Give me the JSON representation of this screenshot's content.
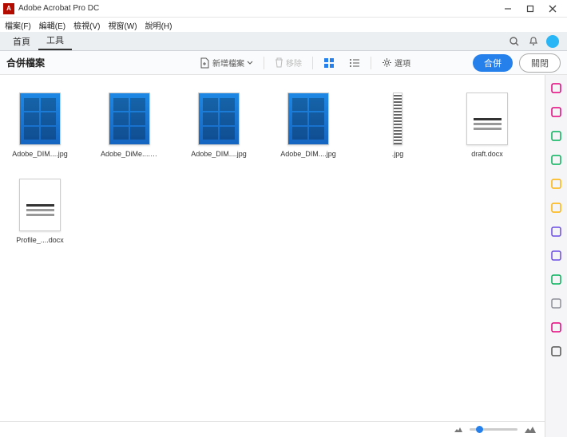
{
  "window": {
    "title": "Adobe Acrobat Pro DC"
  },
  "menu": {
    "file": "檔案(F)",
    "edit": "編輯(E)",
    "view": "檢視(V)",
    "window": "視窗(W)",
    "help": "說明(H)"
  },
  "tabs": {
    "home": "首頁",
    "tools": "工具"
  },
  "toolbar": {
    "title": "合併檔案",
    "add": "新增檔案",
    "delete": "移除",
    "options": "選項",
    "combine": "合併",
    "close": "關閉"
  },
  "files": [
    {
      "name": "Adobe_DIM....jpg",
      "kind": "blue"
    },
    {
      "name": "Adobe_DiMe....jpg",
      "kind": "blue"
    },
    {
      "name": "Adobe_DIM....jpg",
      "kind": "blue"
    },
    {
      "name": "Adobe_DIM....jpg",
      "kind": "blue"
    },
    {
      "name": ".jpg",
      "kind": "jpg-narrow"
    },
    {
      "name": "draft.docx",
      "kind": "docstack"
    },
    {
      "name": "Profile_....docx",
      "kind": "doc"
    }
  ],
  "side_icons": [
    {
      "name": "create-pdf-icon",
      "color": "#e6007e"
    },
    {
      "name": "export-pdf-icon",
      "color": "#e6007e"
    },
    {
      "name": "edit-pdf-icon",
      "color": "#00b359"
    },
    {
      "name": "combine-icon",
      "color": "#00b359"
    },
    {
      "name": "organize-icon",
      "color": "#ffb300"
    },
    {
      "name": "comment-icon",
      "color": "#ffb300"
    },
    {
      "name": "sign-icon",
      "color": "#6b4de6"
    },
    {
      "name": "share-icon",
      "color": "#6b4de6"
    },
    {
      "name": "print-icon",
      "color": "#00b359"
    },
    {
      "name": "protect-icon",
      "color": "#8e8e9a"
    },
    {
      "name": "more-icon",
      "color": "#e6007e"
    },
    {
      "name": "tools-config-icon",
      "color": "#555"
    }
  ]
}
